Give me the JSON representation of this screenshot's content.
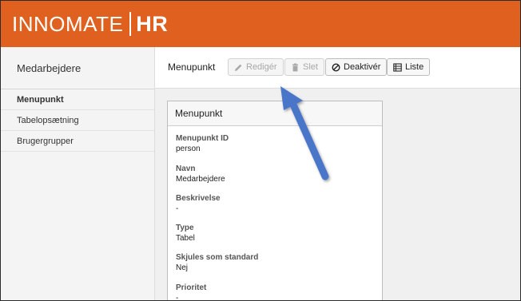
{
  "header": {
    "brand": "INNOMATE",
    "suffix": "HR"
  },
  "sidebar": {
    "title": "Medarbejdere",
    "items": [
      {
        "label": "Menupunkt",
        "active": true
      },
      {
        "label": "Tabelopsætning",
        "active": false
      },
      {
        "label": "Brugergrupper",
        "active": false
      }
    ]
  },
  "toolbar": {
    "title": "Menupunkt",
    "buttons": {
      "edit": {
        "label": "Redigér",
        "icon": "pencil-icon",
        "disabled": true
      },
      "delete": {
        "label": "Slet",
        "icon": "trash-icon",
        "disabled": true
      },
      "deactivate": {
        "label": "Deaktivér",
        "icon": "ban-icon",
        "disabled": false
      },
      "list": {
        "label": "Liste",
        "icon": "list-icon",
        "disabled": false
      }
    }
  },
  "panel": {
    "title": "Menupunkt",
    "fields": [
      {
        "label": "Menupunkt ID",
        "value": "person"
      },
      {
        "label": "Navn",
        "value": "Medarbejdere"
      },
      {
        "label": "Beskrivelse",
        "value": "-"
      },
      {
        "label": "Type",
        "value": "Tabel"
      },
      {
        "label": "Skjules som standard",
        "value": "Nej"
      },
      {
        "label": "Prioritet",
        "value": "-"
      }
    ]
  },
  "colors": {
    "brand": "#e0611f",
    "annotation_arrow": "#4a76c9"
  }
}
